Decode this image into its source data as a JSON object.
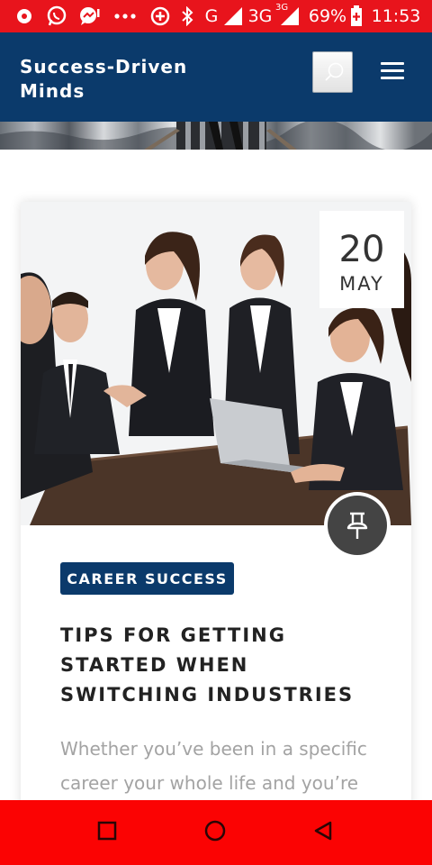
{
  "status_bar": {
    "battery": "69%",
    "time": "11:53",
    "network_label": "G",
    "network_3g": "3G",
    "network_3g_small": "3G",
    "icons": [
      "notification-icon",
      "whatsapp-icon",
      "messenger-icon",
      "more-dots-icon",
      "data-saver-icon",
      "bluetooth-icon",
      "signal-icon",
      "signal-icon",
      "battery-icon"
    ]
  },
  "header": {
    "site_title": "Success-Driven Minds",
    "search_icon": "search-icon",
    "menu_icon": "hamburger-menu-icon",
    "background_color": "#0b3a6b"
  },
  "post": {
    "date_day": "20",
    "date_month": "MAY",
    "format_icon": "pushpin-icon",
    "category": "CAREER SUCCESS",
    "title": "TIPS FOR GETTING STARTED WHEN SWITCHING INDUSTRIES",
    "excerpt": "Whether you’ve been in a specific career your whole life and you’re"
  },
  "nav_bar": {
    "recents_icon": "square-recents-icon",
    "home_icon": "circle-home-icon",
    "back_icon": "triangle-back-icon",
    "background_color": "#fb0303"
  }
}
